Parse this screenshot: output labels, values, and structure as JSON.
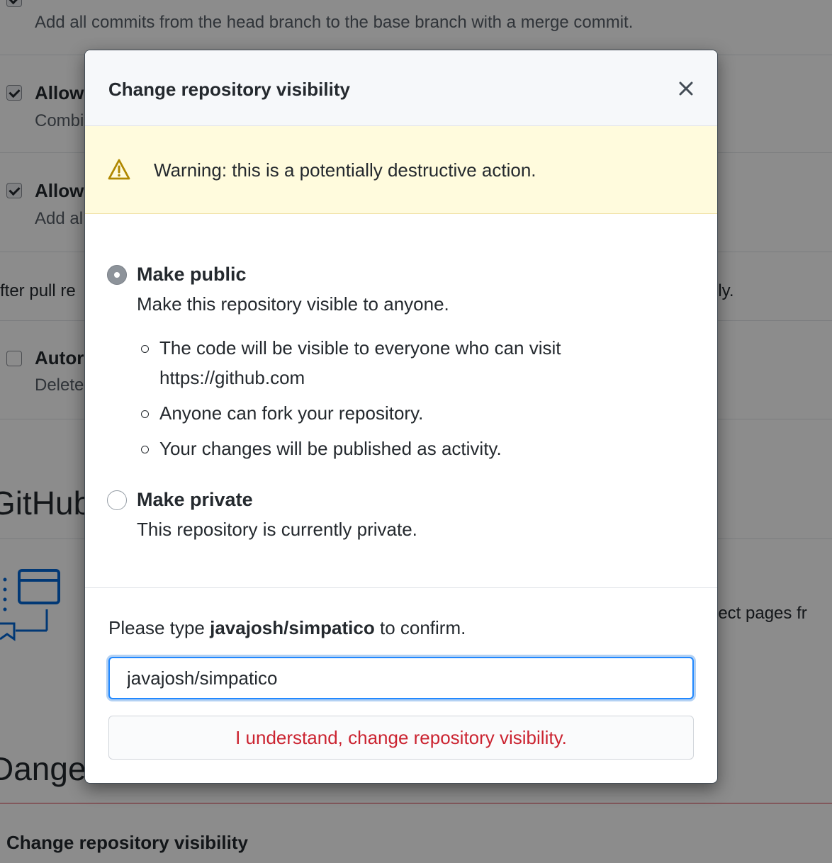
{
  "background": {
    "merge_commits_desc": "Add all commits from the head branch to the base branch with a merge commit.",
    "squash_title": "Allow",
    "squash_desc": "Combi",
    "rebase_title": "Allow",
    "rebase_desc": "Add al",
    "after_pr_text": "fter pull re",
    "after_pr_tail": "lly.",
    "auto_delete_title": "Autor",
    "auto_delete_desc": "Delete",
    "github_pages_heading": "GitHub",
    "pages_desc_tail": "ject pages fr",
    "danger_heading": "Danger",
    "danger_change_visibility": "Change repository visibility"
  },
  "modal": {
    "title": "Change repository visibility",
    "warning": "Warning: this is a potentially destructive action.",
    "options": {
      "public": {
        "label": "Make public",
        "description": "Make this repository visible to anyone.",
        "selected": true,
        "bullets": [
          "The code will be visible to everyone who can visit https://github.com",
          "Anyone can fork your repository.",
          "Your changes will be published as activity."
        ]
      },
      "private": {
        "label": "Make private",
        "description": "This repository is currently private.",
        "selected": false
      }
    },
    "confirm": {
      "prompt_before": "Please type ",
      "repo_name": "javajosh/simpatico",
      "prompt_after": " to confirm.",
      "input_value": "javajosh/simpatico",
      "button_label": "I understand, change repository visibility."
    }
  },
  "colors": {
    "danger_text": "#cb2431",
    "warning_bg": "#fffbdd",
    "focus_border": "#2188ff",
    "warning_icon": "#b08800"
  },
  "icons": {
    "close": "x-icon",
    "warning": "alert-triangle-icon"
  }
}
